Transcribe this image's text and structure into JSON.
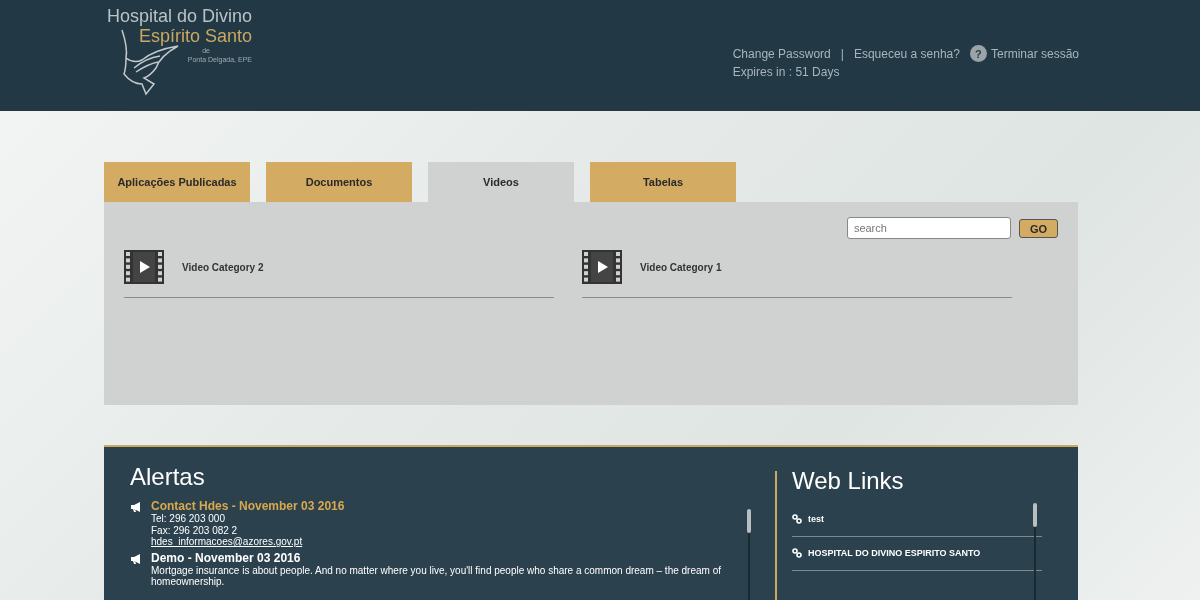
{
  "logo": {
    "line_1": "Hospital do Divino",
    "line_2": "Espírito Santo",
    "line_3": "de",
    "line_4": "Ponta Delgada, EPE"
  },
  "account": {
    "change_password": "Change Password",
    "separator": "|",
    "forgot": "Esqueceu a senha?",
    "help": "?",
    "logout": "Terminar sessão",
    "expires": "Expires in : 51 Days"
  },
  "tabs": [
    {
      "label": "Aplicações Publicadas",
      "selected": false
    },
    {
      "label": "Documentos",
      "selected": false
    },
    {
      "label": "Videos",
      "selected": true
    },
    {
      "label": "Tabelas",
      "selected": false
    }
  ],
  "search": {
    "placeholder": "search",
    "button": "GO"
  },
  "videos": [
    {
      "label": "Video Category 2"
    },
    {
      "label": "Video Category 1"
    }
  ],
  "alerts": {
    "title": "Alertas",
    "items": [
      {
        "title": "Contact Hdes - November 03 2016",
        "highlighted": true,
        "lines": [
          "Tel: 296 203 000",
          "Fax: 296 203 082 2"
        ],
        "link": "hdes_informacoes@azores.gov.pt"
      },
      {
        "title": "Demo - November 03 2016",
        "highlighted": false,
        "lines": [
          "Mortgage insurance is about people. And no matter where you live, you'll find people who share a common dream – the dream of homeownership."
        ]
      }
    ]
  },
  "web_links": {
    "title": "Web Links",
    "items": [
      {
        "label": "test"
      },
      {
        "label": "HOSPITAL DO DIVINO ESPIRITO SANTO"
      }
    ]
  }
}
